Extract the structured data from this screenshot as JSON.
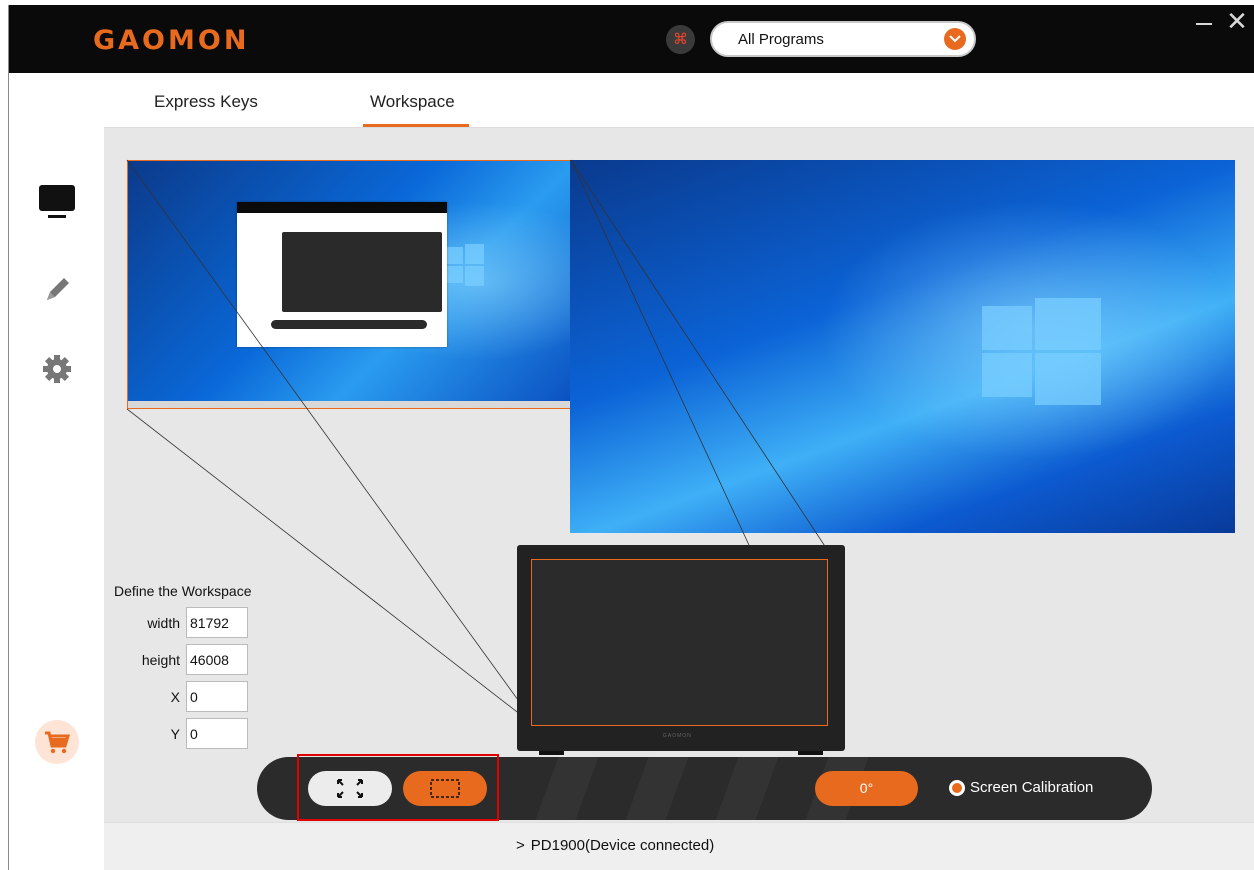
{
  "brand": {
    "logo_text": "GAOMON",
    "accent": "#e76a1e"
  },
  "header": {
    "app_icon": "app-grid-icon",
    "program_select": {
      "value": "All Programs"
    }
  },
  "tabs": [
    {
      "label": "Express Keys",
      "active": false
    },
    {
      "label": "Workspace",
      "active": true
    }
  ],
  "sidebar": {
    "items": [
      {
        "icon": "monitor-icon",
        "active": true
      },
      {
        "icon": "pen-icon",
        "active": false
      },
      {
        "icon": "gear-icon",
        "active": false
      },
      {
        "icon": "cart-icon",
        "active": false
      }
    ]
  },
  "workspace": {
    "title": "Define the Workspace",
    "fields": [
      {
        "label": "width",
        "value": "81792"
      },
      {
        "label": "height",
        "value": "46008"
      },
      {
        "label": "X",
        "value": "0"
      },
      {
        "label": "Y",
        "value": "0"
      }
    ]
  },
  "toolbar": {
    "rotation": "0°",
    "calibration_label": "Screen Calibration",
    "calibration_checked": true
  },
  "footer": {
    "device_status": "PD1900(Device connected)"
  }
}
